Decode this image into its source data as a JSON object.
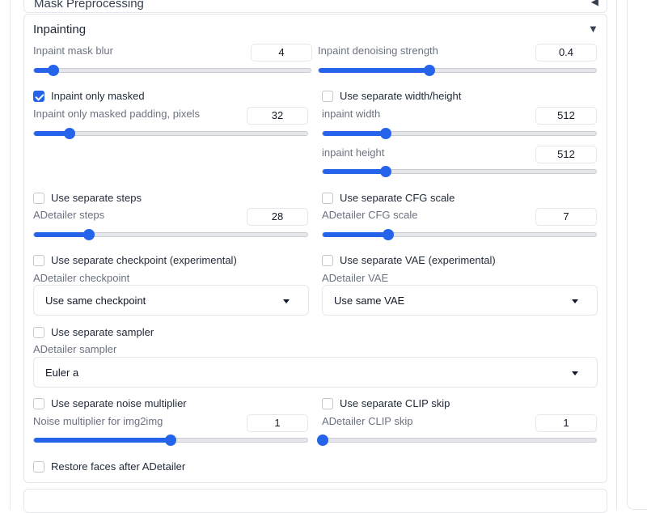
{
  "previous_panel": {
    "title": "Mask Preprocessing"
  },
  "panel": {
    "title": "Inpainting"
  },
  "fields": {
    "mask_blur": {
      "label": "Inpaint mask blur",
      "value": "4",
      "fraction": 0.07
    },
    "denoising": {
      "label": "Inpaint denoising strength",
      "value": "0.4",
      "fraction": 0.4
    },
    "only_masked": {
      "label": "Inpaint only masked",
      "checked": true
    },
    "only_masked_padding": {
      "label": "Inpaint only masked padding, pixels",
      "value": "32",
      "fraction": 0.13
    },
    "separate_wh": {
      "label": "Use separate width/height",
      "checked": false
    },
    "width": {
      "label": "inpaint width",
      "value": "512",
      "fraction": 0.23
    },
    "height": {
      "label": "inpaint height",
      "value": "512",
      "fraction": 0.23
    },
    "separate_steps": {
      "label": "Use separate steps",
      "checked": false
    },
    "steps": {
      "label": "ADetailer steps",
      "value": "28",
      "fraction": 0.2
    },
    "separate_cfg": {
      "label": "Use separate CFG scale",
      "checked": false
    },
    "cfg": {
      "label": "ADetailer CFG scale",
      "value": "7",
      "fraction": 0.24
    },
    "separate_checkpoint": {
      "label": "Use separate checkpoint (experimental)",
      "checked": false
    },
    "checkpoint": {
      "label": "ADetailer checkpoint",
      "value": "Use same checkpoint"
    },
    "separate_vae": {
      "label": "Use separate VAE (experimental)",
      "checked": false
    },
    "vae": {
      "label": "ADetailer VAE",
      "value": "Use same VAE"
    },
    "separate_sampler": {
      "label": "Use separate sampler",
      "checked": false
    },
    "sampler": {
      "label": "ADetailer sampler",
      "value": "Euler a"
    },
    "separate_noise": {
      "label": "Use separate noise multiplier",
      "checked": false
    },
    "noise": {
      "label": "Noise multiplier for img2img",
      "value": "1",
      "fraction": 0.5
    },
    "separate_clip": {
      "label": "Use separate CLIP skip",
      "checked": false
    },
    "clip": {
      "label": "ADetailer CLIP skip",
      "value": "1",
      "fraction": 0.0
    },
    "restore_faces": {
      "label": "Restore faces after ADetailer",
      "checked": false
    }
  },
  "colors": {
    "accent": "#2563eb",
    "track": "#e5e7eb",
    "border": "#e5e7eb"
  }
}
